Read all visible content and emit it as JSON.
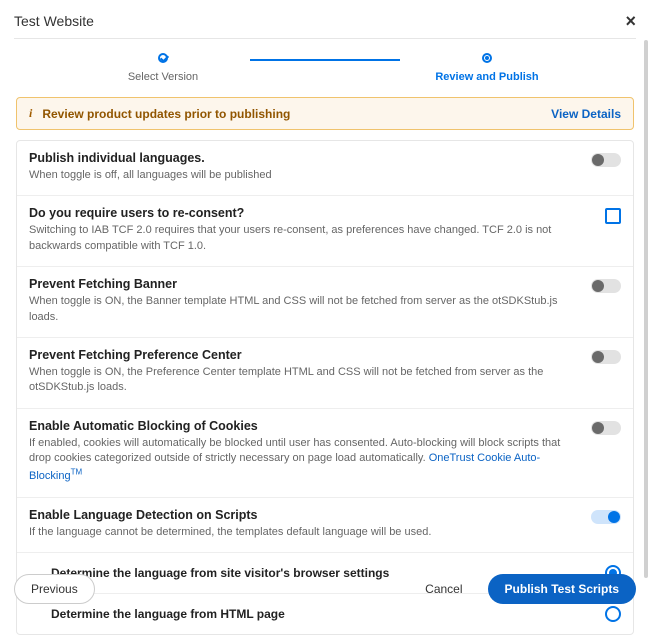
{
  "header": {
    "title": "Test Website",
    "close_label": "×"
  },
  "stepper": {
    "step1_label": "Select Version",
    "step2_label": "Review and Publish"
  },
  "banner": {
    "icon_glyph": "i",
    "message": "Review product updates prior to publishing",
    "link_label": "View Details"
  },
  "options": [
    {
      "key": "publish_langs",
      "title": "Publish individual languages.",
      "desc": "When toggle is off, all languages will be published",
      "control": "toggle",
      "value": false
    },
    {
      "key": "reconsent",
      "title": "Do you require users to re-consent?",
      "desc": "Switching to IAB TCF 2.0 requires that your users re-consent, as preferences have changed. TCF 2.0 is not backwards compatible with TCF 1.0.",
      "control": "checkbox",
      "value": false
    },
    {
      "key": "prevent_banner",
      "title": "Prevent Fetching Banner",
      "desc": "When toggle is ON, the Banner template HTML and CSS will not be fetched from server as the otSDKStub.js loads.",
      "control": "toggle",
      "value": false
    },
    {
      "key": "prevent_pc",
      "title": "Prevent Fetching Preference Center",
      "desc": "When toggle is ON, the Preference Center template HTML and CSS will not be fetched from server as the otSDKStub.js loads.",
      "control": "toggle",
      "value": false
    },
    {
      "key": "auto_block",
      "title": "Enable Automatic Blocking of Cookies",
      "desc_pre": "If enabled, cookies will automatically be blocked until user has consented. Auto-blocking will block scripts that drop cookies categorized outside of strictly necessary on page load automatically. ",
      "link_text": "OneTrust Cookie Auto-Blocking",
      "tm": "TM",
      "control": "toggle",
      "value": false
    },
    {
      "key": "lang_detect",
      "title": "Enable Language Detection on Scripts",
      "desc": "If the language cannot be determined, the templates default language will be used.",
      "control": "toggle",
      "value": true
    }
  ],
  "lang_sub": {
    "selected": "browser",
    "opt_browser": "Determine the language from site visitor's browser settings",
    "opt_html": "Determine the language from HTML page"
  },
  "footer": {
    "previous": "Previous",
    "cancel": "Cancel",
    "publish": "Publish Test Scripts"
  }
}
